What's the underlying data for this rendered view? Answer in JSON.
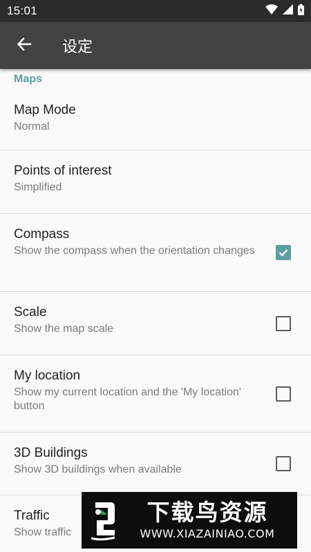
{
  "status_bar": {
    "time": "15:01"
  },
  "app_bar": {
    "title": "设定"
  },
  "section": {
    "title": "Maps"
  },
  "preferences": [
    {
      "title": "Map Mode",
      "summary": "Normal",
      "has_checkbox": false
    },
    {
      "title": "Points of interest",
      "summary": "Simplified",
      "has_checkbox": false
    },
    {
      "title": "Compass",
      "summary": "Show the compass when the orientation changes",
      "has_checkbox": true,
      "checked": true
    },
    {
      "title": "Scale",
      "summary": "Show the map scale",
      "has_checkbox": true,
      "checked": false
    },
    {
      "title": "My location",
      "summary": "Show my current location and the 'My location' button",
      "has_checkbox": true,
      "checked": false
    },
    {
      "title": "3D Buildings",
      "summary": "Show 3D buildings when available",
      "has_checkbox": true,
      "checked": false
    },
    {
      "title": "Traffic",
      "summary": "Show traffic",
      "has_checkbox": true,
      "checked": false
    }
  ],
  "watermark": {
    "title": "下载鸟资源",
    "url": "WWW.XIAZAINIAO.COM"
  },
  "colors": {
    "accent": "#5e9ea0",
    "app_bar": "#424242",
    "status_bar": "#2b2b2b"
  }
}
